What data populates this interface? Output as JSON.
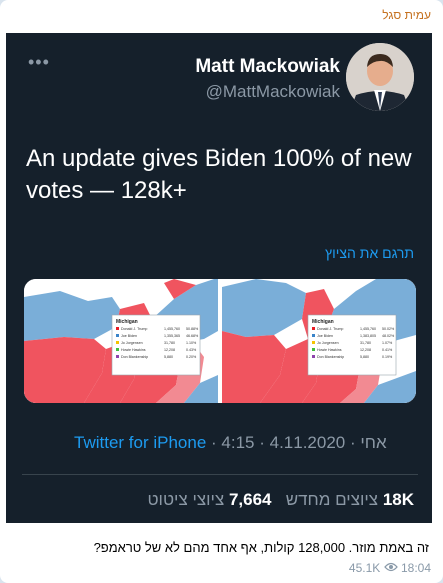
{
  "post": {
    "author": "עמית סגל",
    "caption": "זה באמת מוזר. 128,000 קולות, אף אחד מהם לא של טראמפ?",
    "views": "45.1K",
    "time": "18:04",
    "views_icon": "eye-icon"
  },
  "tweet": {
    "more_icon": "ellipsis-icon",
    "display_name": "Matt Mackowiak",
    "handle": "@MattMackowiak",
    "text": "An update gives Biden 100% of new votes — 128k+",
    "translate": "תרגם את הציוץ",
    "source": "Twitter for iPhone",
    "timestamp": "4:15 · אחי · 4.11.2020",
    "stats": {
      "retweets_count": "7,664",
      "retweets_label": "ציוצי ציטוט",
      "quotes_count": "18K",
      "quotes_label": "ציוצים מחדש"
    },
    "media": {
      "left_panel": {
        "title": "Michigan",
        "rows": [
          {
            "name": "Donald J. Trump",
            "votes": "1,455,760",
            "pct": "50.88%",
            "color": "#e81b23"
          },
          {
            "name": "Joe Biden",
            "votes": "1,355,365",
            "pct": "46.68%",
            "color": "#3a84c9"
          },
          {
            "name": "Jo Jorgensen",
            "votes": "31,780",
            "pct": "1.10%",
            "color": "#f5c400"
          },
          {
            "name": "Howie Hawkins",
            "votes": "12,208",
            "pct": "0.43%",
            "color": "#3fbf3f"
          },
          {
            "name": "Don Blankenship",
            "votes": "5,880",
            "pct": "0.20%",
            "color": "#8e44ad"
          }
        ]
      },
      "right_panel": {
        "title": "Michigan",
        "rows": [
          {
            "name": "Donald J. Trump",
            "votes": "1,455,760",
            "pct": "50.02%",
            "color": "#e81b23"
          },
          {
            "name": "Joe Biden",
            "votes": "1,383,805",
            "pct": "48.02%",
            "color": "#3a84c9"
          },
          {
            "name": "Jo Jorgensen",
            "votes": "31,780",
            "pct": "1.07%",
            "color": "#f5c400"
          },
          {
            "name": "Howie Hawkins",
            "votes": "12,208",
            "pct": "0.41%",
            "color": "#3fbf3f"
          },
          {
            "name": "Don Blankenship",
            "votes": "5,880",
            "pct": "0.19%",
            "color": "#8e44ad"
          }
        ]
      }
    }
  },
  "colors": {
    "tweet_bg": "#15202b",
    "link": "#1d9bf0",
    "muted": "#8b98a5",
    "author": "#c5711f",
    "red_state": "#f0545f",
    "blue_state": "#7aaed8"
  }
}
